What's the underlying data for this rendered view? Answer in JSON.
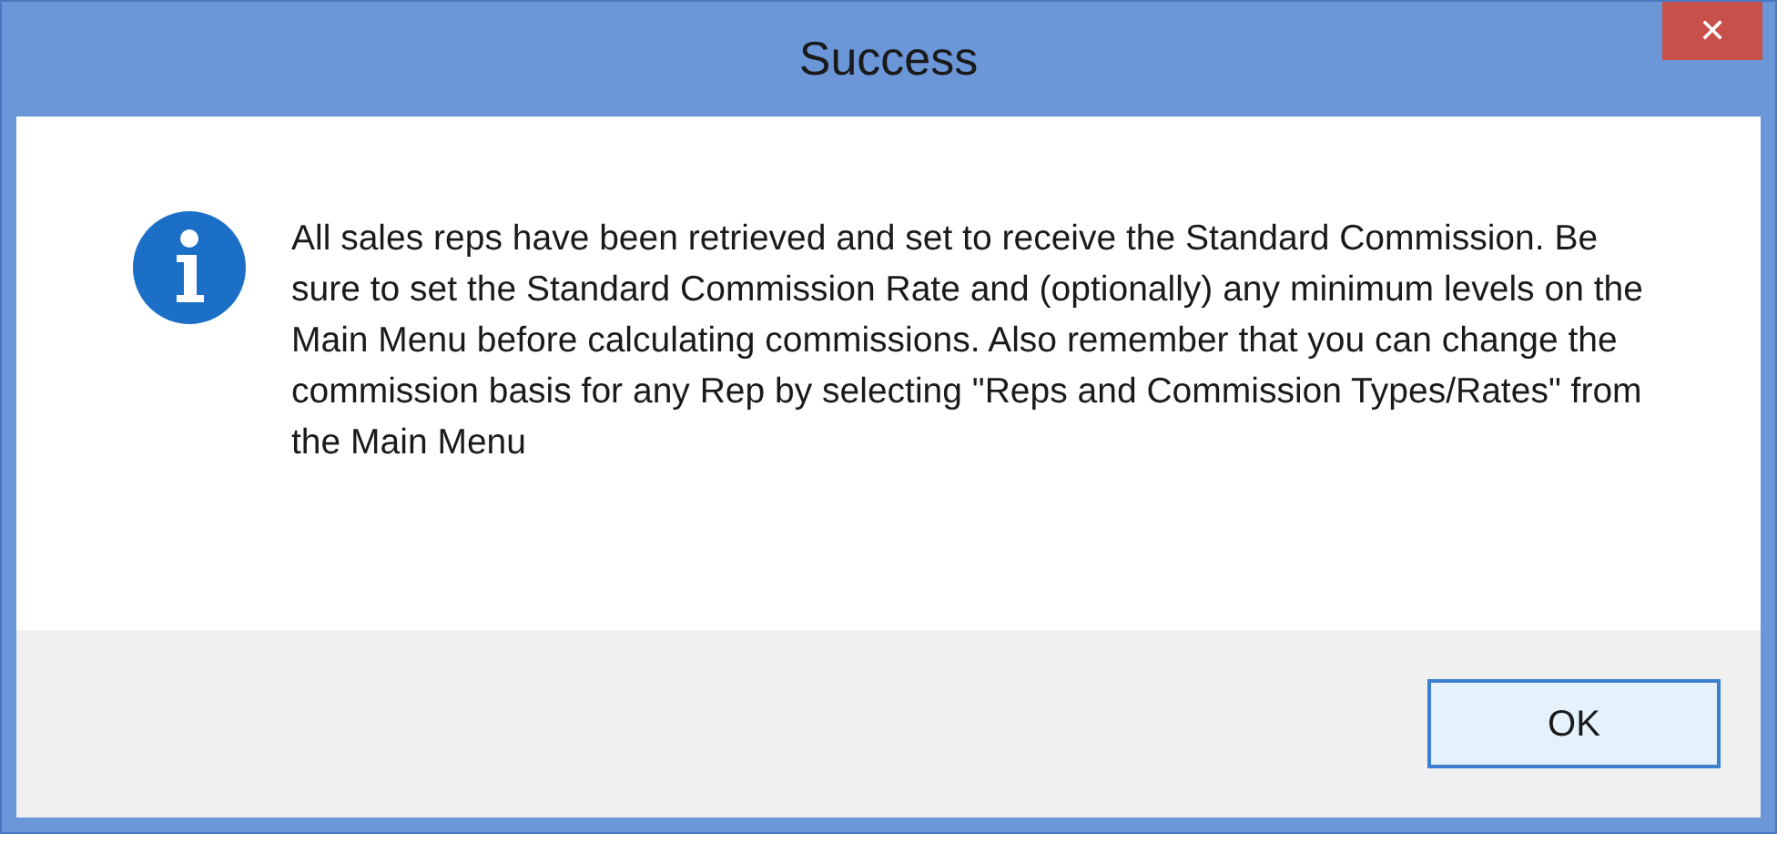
{
  "window": {
    "title": "Success",
    "close": "✕"
  },
  "message": "All sales reps have been retrieved and set to receive the Standard Commission. Be sure to set the Standard Commission Rate and (optionally) any minimum levels on the Main Menu before calculating commissions. Also remember that you can change the commission basis for any Rep by selecting \"Reps and Commission Types/Rates\" from the Main Menu",
  "buttons": [
    "OK"
  ]
}
